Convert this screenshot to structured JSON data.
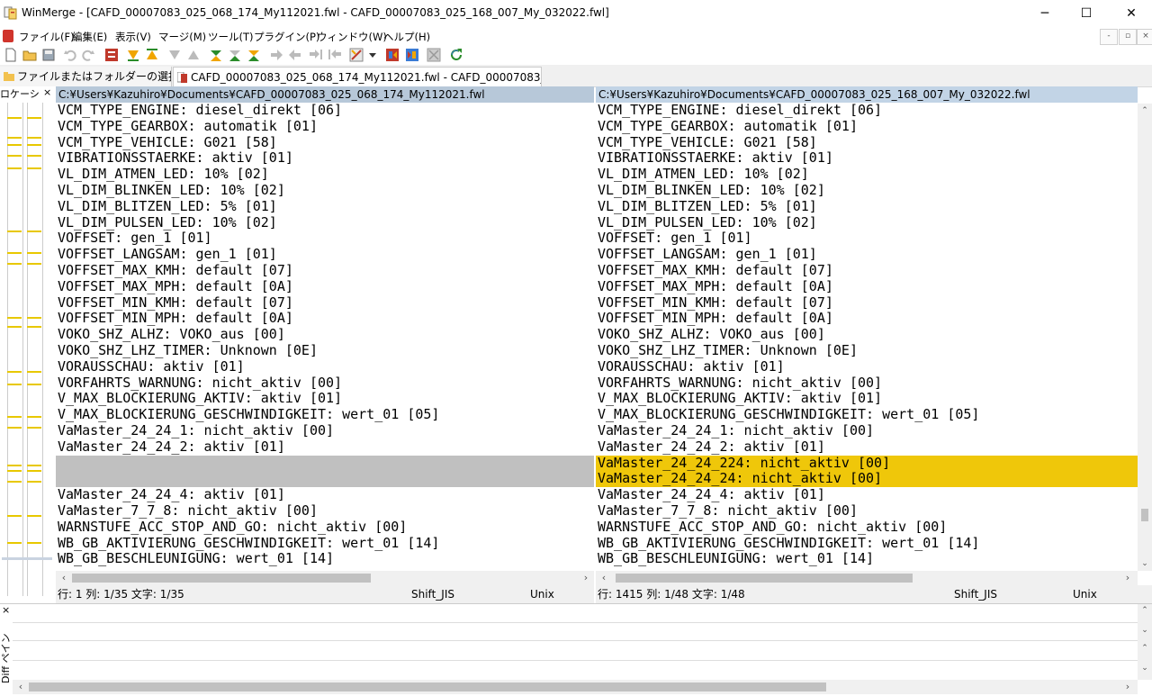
{
  "window": {
    "title": "WinMerge - [CAFD_00007083_025_068_174_My112021.fwl - CAFD_00007083_025_168_007_My_032022.fwl]",
    "minimize": "─",
    "maximize": "☐",
    "close": "✕"
  },
  "menu": {
    "items": [
      "ファイル(F)",
      "編集(E)",
      "表示(V)",
      "マージ(M)",
      "ツール(T)",
      "プラグイン(P)",
      "ウィンドウ(W)",
      "ヘルプ(H)"
    ],
    "mdi": [
      "-",
      "▫",
      "×"
    ]
  },
  "tabs": [
    {
      "label": "ファイルまたはフォルダーの選択..."
    },
    {
      "label": "CAFD_00007083_025_068_174_My112021.fwl - CAFD_00007083_..."
    }
  ],
  "location_pane": {
    "title": "ロケーシ",
    "close": "×"
  },
  "left": {
    "path": "C:¥Users¥Kazuhiro¥Documents¥CAFD_00007083_025_068_174_My112021.fwl",
    "lines": [
      {
        "text": "VCM_TYPE_ENGINE: diesel_direkt [06]",
        "state": "normal"
      },
      {
        "text": "VCM_TYPE_GEARBOX: automatik [01]",
        "state": "normal"
      },
      {
        "text": "VCM_TYPE_VEHICLE: G021 [58]",
        "state": "normal"
      },
      {
        "text": "VIBRATIONSSTAERKE: aktiv [01]",
        "state": "normal"
      },
      {
        "text": "VL_DIM_ATMEN_LED: 10% [02]",
        "state": "normal"
      },
      {
        "text": "VL_DIM_BLINKEN_LED: 10% [02]",
        "state": "normal"
      },
      {
        "text": "VL_DIM_BLITZEN_LED: 5% [01]",
        "state": "normal"
      },
      {
        "text": "VL_DIM_PULSEN_LED: 10% [02]",
        "state": "normal"
      },
      {
        "text": "VOFFSET: gen_1 [01]",
        "state": "normal"
      },
      {
        "text": "VOFFSET_LANGSAM: gen_1 [01]",
        "state": "normal"
      },
      {
        "text": "VOFFSET_MAX_KMH: default [07]",
        "state": "normal"
      },
      {
        "text": "VOFFSET_MAX_MPH: default [0A]",
        "state": "normal"
      },
      {
        "text": "VOFFSET_MIN_KMH: default [07]",
        "state": "normal"
      },
      {
        "text": "VOFFSET_MIN_MPH: default [0A]",
        "state": "normal"
      },
      {
        "text": "VOKO_SHZ_ALHZ: VOKO_aus [00]",
        "state": "normal"
      },
      {
        "text": "VOKO_SHZ_LHZ_TIMER: Unknown [0E]",
        "state": "normal"
      },
      {
        "text": "VORAUSSCHAU: aktiv [01]",
        "state": "normal"
      },
      {
        "text": "VORFAHRTS_WARNUNG: nicht_aktiv [00]",
        "state": "normal"
      },
      {
        "text": "V_MAX_BLOCKIERUNG_AKTIV: aktiv [01]",
        "state": "normal"
      },
      {
        "text": "V_MAX_BLOCKIERUNG_GESCHWINDIGKEIT: wert_01 [05]",
        "state": "normal"
      },
      {
        "text": "VaMaster_24_24_1: nicht_aktiv [00]",
        "state": "normal"
      },
      {
        "text": "VaMaster_24_24_2: aktiv [01]",
        "state": "normal"
      },
      {
        "text": "",
        "state": "gap"
      },
      {
        "text": "",
        "state": "gap"
      },
      {
        "text": "VaMaster_24_24_4: aktiv [01]",
        "state": "normal"
      },
      {
        "text": "VaMaster_7_7_8: nicht_aktiv [00]",
        "state": "normal"
      },
      {
        "text": "WARNSTUFE_ACC_STOP_AND_GO: nicht_aktiv [00]",
        "state": "normal"
      },
      {
        "text": "WB_GB_AKTIVIERUNG_GESCHWINDIGKEIT: wert_01 [14]",
        "state": "normal"
      },
      {
        "text": "WB_GB_BESCHLEUNIGUNG: wert_01 [14]",
        "state": "normal"
      }
    ]
  },
  "right": {
    "path": "C:¥Users¥Kazuhiro¥Documents¥CAFD_00007083_025_168_007_My_032022.fwl",
    "lines": [
      {
        "text": "VCM_TYPE_ENGINE: diesel_direkt [06]",
        "state": "normal"
      },
      {
        "text": "VCM_TYPE_GEARBOX: automatik [01]",
        "state": "normal"
      },
      {
        "text": "VCM_TYPE_VEHICLE: G021 [58]",
        "state": "normal"
      },
      {
        "text": "VIBRATIONSSTAERKE: aktiv [01]",
        "state": "normal"
      },
      {
        "text": "VL_DIM_ATMEN_LED: 10% [02]",
        "state": "normal"
      },
      {
        "text": "VL_DIM_BLINKEN_LED: 10% [02]",
        "state": "normal"
      },
      {
        "text": "VL_DIM_BLITZEN_LED: 5% [01]",
        "state": "normal"
      },
      {
        "text": "VL_DIM_PULSEN_LED: 10% [02]",
        "state": "normal"
      },
      {
        "text": "VOFFSET: gen_1 [01]",
        "state": "normal"
      },
      {
        "text": "VOFFSET_LANGSAM: gen_1 [01]",
        "state": "normal"
      },
      {
        "text": "VOFFSET_MAX_KMH: default [07]",
        "state": "normal"
      },
      {
        "text": "VOFFSET_MAX_MPH: default [0A]",
        "state": "normal"
      },
      {
        "text": "VOFFSET_MIN_KMH: default [07]",
        "state": "normal"
      },
      {
        "text": "VOFFSET_MIN_MPH: default [0A]",
        "state": "normal"
      },
      {
        "text": "VOKO_SHZ_ALHZ: VOKO_aus [00]",
        "state": "normal"
      },
      {
        "text": "VOKO_SHZ_LHZ_TIMER: Unknown [0E]",
        "state": "normal"
      },
      {
        "text": "VORAUSSCHAU: aktiv [01]",
        "state": "normal"
      },
      {
        "text": "VORFAHRTS_WARNUNG: nicht_aktiv [00]",
        "state": "normal"
      },
      {
        "text": "V_MAX_BLOCKIERUNG_AKTIV: aktiv [01]",
        "state": "normal"
      },
      {
        "text": "V_MAX_BLOCKIERUNG_GESCHWINDIGKEIT: wert_01 [05]",
        "state": "normal"
      },
      {
        "text": "VaMaster_24_24_1: nicht_aktiv [00]",
        "state": "normal"
      },
      {
        "text": "VaMaster_24_24_2: aktiv [01]",
        "state": "normal"
      },
      {
        "text": "VaMaster_24_24_224: nicht_aktiv [00]",
        "state": "diff"
      },
      {
        "text": "VaMaster_24_24_24: nicht_aktiv [00]",
        "state": "diff"
      },
      {
        "text": "VaMaster_24_24_4: aktiv [01]",
        "state": "normal"
      },
      {
        "text": "VaMaster_7_7_8: nicht_aktiv [00]",
        "state": "normal"
      },
      {
        "text": "WARNSTUFE_ACC_STOP_AND_GO: nicht_aktiv [00]",
        "state": "normal"
      },
      {
        "text": "WB_GB_AKTIVIERUNG_GESCHWINDIGKEIT: wert_01 [14]",
        "state": "normal"
      },
      {
        "text": "WB_GB_BESCHLEUNIGUNG: wert_01 [14]",
        "state": "normal"
      }
    ]
  },
  "status_left": {
    "position": "行: 1  列: 1/35  文字: 1/35",
    "encoding": "Shift_JIS",
    "eol": "Unix"
  },
  "status_right": {
    "position": "行: 1415  列: 1/48  文字: 1/48",
    "encoding": "Shift_JIS",
    "eol": "Unix"
  },
  "diff_pane": {
    "label": "Diff ペイン",
    "close": "×"
  },
  "scroll": {
    "up": "⌃",
    "down": "⌄",
    "left": "‹",
    "right": "›"
  },
  "colors": {
    "diff_highlight": "#efc70a",
    "gap": "#c0c0c0",
    "path_header": "#b7c8d9",
    "location_mark": "#e8c800"
  }
}
